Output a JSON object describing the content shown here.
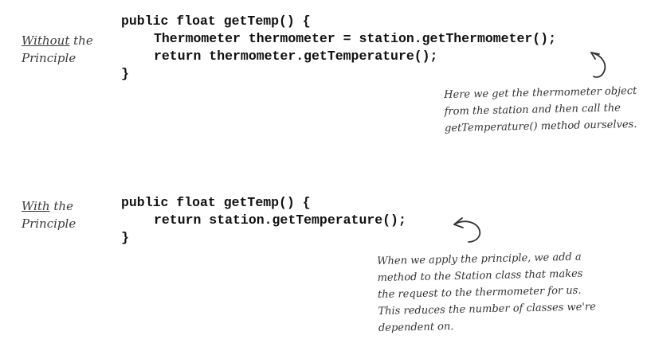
{
  "without": {
    "label_line1_underlined": "Without",
    "label_line1_rest": " the",
    "label_line2": "Principle",
    "code": [
      "public float getTemp() {",
      "Thermometer thermometer = station.getThermometer();",
      "return thermometer.getTemperature();",
      "}"
    ],
    "note": [
      "Here we get the thermometer object",
      "from the station and then call the",
      "getTemperature() method ourselves."
    ]
  },
  "with": {
    "label_line1_underlined": "With",
    "label_line1_rest": " the",
    "label_line2": "Principle",
    "code": [
      "public float getTemp() {",
      "return station.getTemperature();",
      "}"
    ],
    "note": [
      "When we apply the principle, we add a",
      "method to the Station class that makes",
      "the request to the thermometer for us.",
      "This reduces the number of classes we're",
      "dependent on."
    ]
  }
}
